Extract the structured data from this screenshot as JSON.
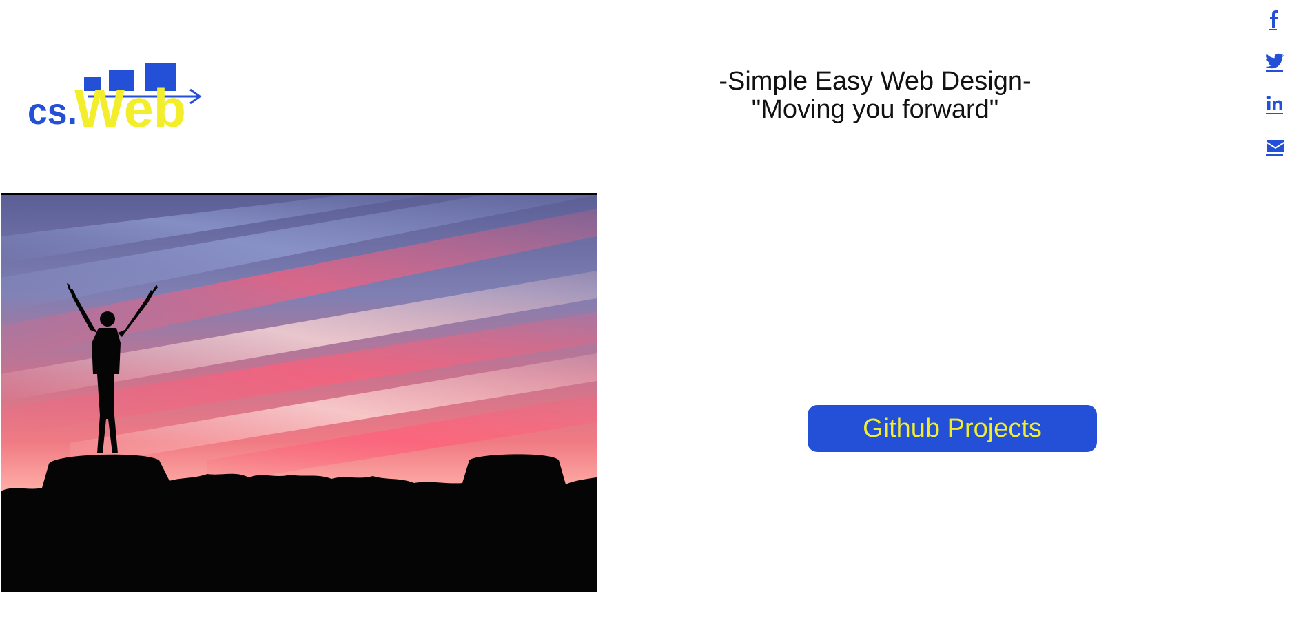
{
  "logo": {
    "prefix": "cs.",
    "name": "Web",
    "colors": {
      "blue": "#2350d6",
      "yellow": "#f2ee2b"
    }
  },
  "tagline": {
    "line1": "-Simple Easy Web Design-",
    "line2": "\"Moving you forward\""
  },
  "social": [
    {
      "icon": "facebook-icon"
    },
    {
      "icon": "twitter-icon"
    },
    {
      "icon": "linkedin-icon"
    },
    {
      "icon": "email-icon"
    }
  ],
  "hero": {
    "description": "silhouette-at-sunset"
  },
  "github_button": {
    "label": "Github Projects"
  },
  "colors": {
    "accent": "#2350d6",
    "button_text": "#f2ee2b",
    "text": "#111111",
    "background": "#ffffff"
  }
}
